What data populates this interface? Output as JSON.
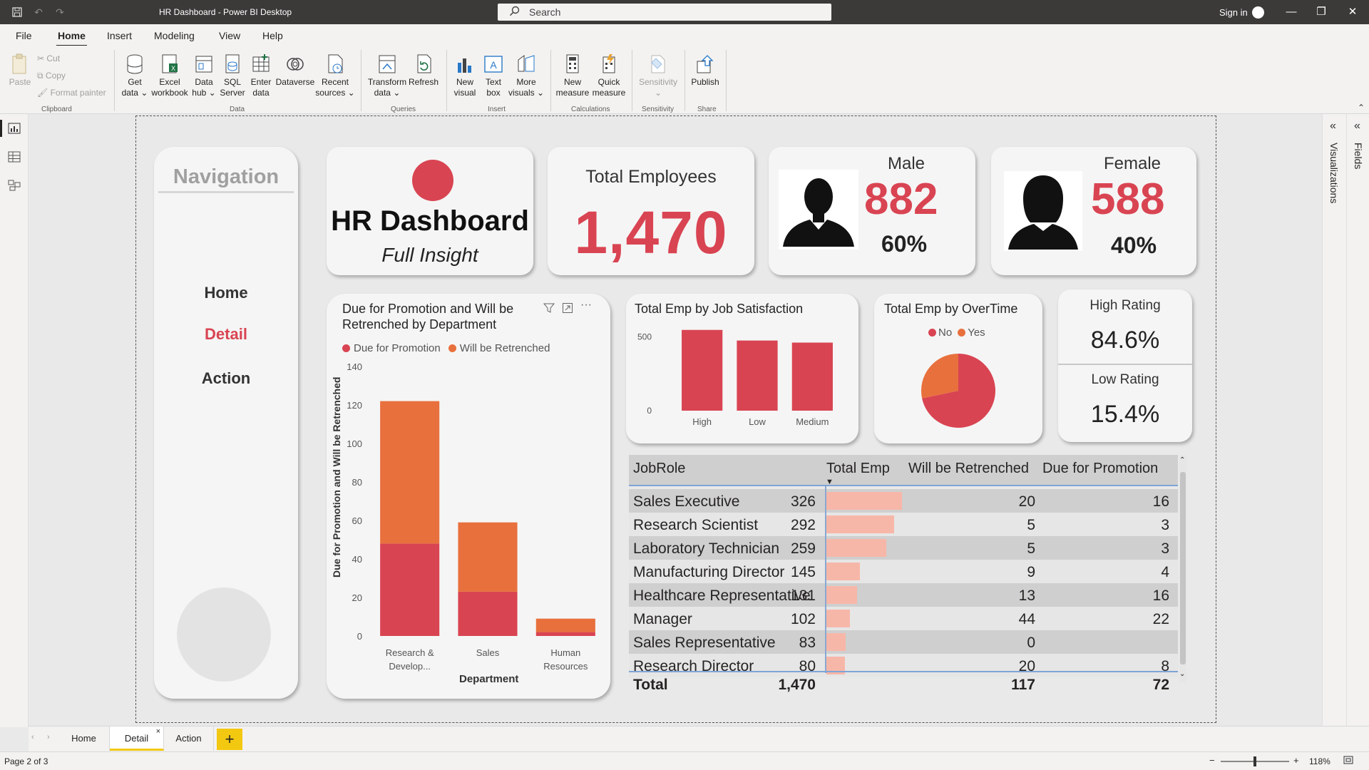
{
  "window": {
    "title": "HR Dashboard - Power BI Desktop",
    "search_placeholder": "Search",
    "sign_in": "Sign in"
  },
  "ribbon_tabs": [
    "File",
    "Home",
    "Insert",
    "Modeling",
    "View",
    "Help"
  ],
  "ribbon": {
    "clipboard": {
      "paste": "Paste",
      "cut": "Cut",
      "copy": "Copy",
      "format_painter": "Format painter",
      "group": "Clipboard"
    },
    "data": {
      "get_data": [
        "Get",
        "data ⌄"
      ],
      "excel": [
        "Excel",
        "workbook"
      ],
      "data_hub": [
        "Data",
        "hub ⌄"
      ],
      "sql": [
        "SQL",
        "Server"
      ],
      "enter": [
        "Enter",
        "data"
      ],
      "dataverse": [
        "Dataverse",
        ""
      ],
      "recent": [
        "Recent",
        "sources ⌄"
      ],
      "group": "Data"
    },
    "queries": {
      "transform": [
        "Transform",
        "data ⌄"
      ],
      "refresh": [
        "Refresh",
        ""
      ],
      "group": "Queries"
    },
    "insert": {
      "new_visual": [
        "New",
        "visual"
      ],
      "text_box": [
        "Text",
        "box"
      ],
      "more_visuals": [
        "More",
        "visuals ⌄"
      ],
      "group": "Insert"
    },
    "calculations": {
      "new_measure": [
        "New",
        "measure"
      ],
      "quick_measure": [
        "Quick",
        "measure"
      ],
      "group": "Calculations"
    },
    "sensitivity": {
      "label": [
        "Sensitivity",
        "⌄"
      ],
      "group": "Sensitivity"
    },
    "share": {
      "publish": [
        "Publish",
        ""
      ],
      "group": "Share"
    }
  },
  "right_panes": {
    "visualizations": "Visualizations",
    "fields": "Fields"
  },
  "navigation": {
    "title": "Navigation",
    "items": [
      {
        "label": "Home",
        "active": false
      },
      {
        "label": "Detail",
        "active": true
      },
      {
        "label": "Action",
        "active": false
      }
    ]
  },
  "header": {
    "title": "HR Dashboard",
    "subtitle": "Full Insight"
  },
  "kpis": {
    "total": {
      "label": "Total Employees",
      "value": "1,470"
    },
    "male": {
      "label": "Male",
      "value": "882",
      "pct": "60%"
    },
    "female": {
      "label": "Female",
      "value": "588",
      "pct": "40%"
    }
  },
  "colors": {
    "accent_red": "#d94452",
    "accent_orange": "#e8703d",
    "databar": "#f7b7a8",
    "pbi_yellow": "#f2c811"
  },
  "chart_data": [
    {
      "type": "bar",
      "stacked": true,
      "title": "Due for Promotion and Will be Retrenched by Department",
      "xlabel": "Department",
      "ylabel": "Due for Promotion and Will be Retrenched",
      "categories": [
        "Research & Develop...",
        "Sales",
        "Human Resources"
      ],
      "series": [
        {
          "name": "Due for Promotion",
          "values": [
            48,
            23,
            2
          ]
        },
        {
          "name": "Will be Retrenched",
          "values": [
            74,
            36,
            7
          ]
        }
      ],
      "ylim": [
        0,
        140
      ],
      "yticks": [
        "0",
        "20",
        "40",
        "60",
        "80",
        "100",
        "120",
        "140"
      ],
      "legend": "top-left"
    },
    {
      "type": "bar",
      "title": "Total Emp by Job Satisfaction",
      "categories": [
        "High",
        "Low",
        "Medium"
      ],
      "values": [
        548,
        476,
        462
      ],
      "yticks": [
        "0",
        "500"
      ],
      "ylim": [
        0,
        600
      ]
    },
    {
      "type": "pie",
      "title": "Total Emp by OverTime",
      "labels": [
        "No",
        "Yes"
      ],
      "values": [
        1054,
        416
      ],
      "legend": "top"
    }
  ],
  "ratings": {
    "high": {
      "label": "High Rating",
      "value": "84.6%"
    },
    "low": {
      "label": "Low Rating",
      "value": "15.4%"
    }
  },
  "table": {
    "headers": [
      "JobRole",
      "Total Emp",
      "Will be Retrenched",
      "Due for Promotion"
    ],
    "rows": [
      {
        "role": "Sales Executive",
        "total": "326",
        "total_num": 326,
        "retrenched": "20",
        "promotion": "16"
      },
      {
        "role": "Research Scientist",
        "total": "292",
        "total_num": 292,
        "retrenched": "5",
        "promotion": "3"
      },
      {
        "role": "Laboratory Technician",
        "total": "259",
        "total_num": 259,
        "retrenched": "5",
        "promotion": "3"
      },
      {
        "role": "Manufacturing Director",
        "total": "145",
        "total_num": 145,
        "retrenched": "9",
        "promotion": "4"
      },
      {
        "role": "Healthcare Representative",
        "total": "131",
        "total_num": 131,
        "retrenched": "13",
        "promotion": "16"
      },
      {
        "role": "Manager",
        "total": "102",
        "total_num": 102,
        "retrenched": "44",
        "promotion": "22"
      },
      {
        "role": "Sales Representative",
        "total": "83",
        "total_num": 83,
        "retrenched": "0",
        "promotion": ""
      },
      {
        "role": "Research Director",
        "total": "80",
        "total_num": 80,
        "retrenched": "20",
        "promotion": "8"
      }
    ],
    "total_row": {
      "label": "Total",
      "total": "1,470",
      "retrenched": "117",
      "promotion": "72"
    }
  },
  "pages": {
    "tabs": [
      "Home",
      "Detail",
      "Action"
    ],
    "active": "Detail",
    "add": "+"
  },
  "status": {
    "page": "Page 2 of 3",
    "zoom": "118%"
  }
}
